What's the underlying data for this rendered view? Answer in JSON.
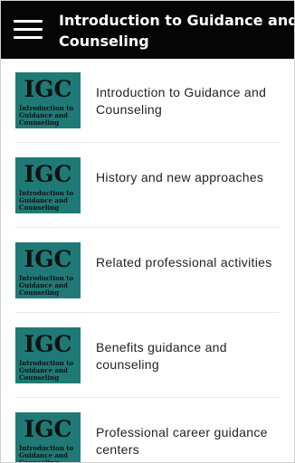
{
  "header": {
    "title": "Introduction to Guidance and Counseling",
    "menu_icon": "hamburger-menu-icon"
  },
  "thumbnail": {
    "big_text": "IGC",
    "small_text": "Introduction to Guidance and Counseling",
    "background_color": "#1f7a77"
  },
  "items": [
    {
      "label": "Introduction to Guidance and Counseling"
    },
    {
      "label": "History and new approaches"
    },
    {
      "label": "Related professional activities"
    },
    {
      "label": "Benefits guidance and counseling"
    },
    {
      "label": "Professional career guidance centers"
    }
  ]
}
